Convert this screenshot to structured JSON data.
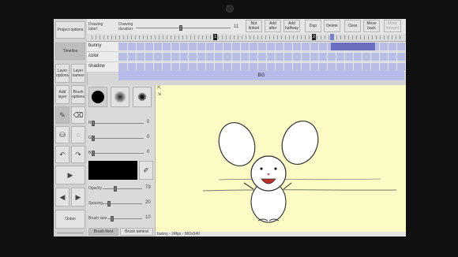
{
  "left_panel": {
    "project_options": "Project options",
    "timeline": "Timeline",
    "layer_options": "Layer options",
    "layer_names": "Layer names",
    "add_layer": "Add layer",
    "brush_options": "Brush options",
    "onion": "Onion"
  },
  "top_bar": {
    "drawing_label": "Drawing label:",
    "drawing_duration": "Drawing duration:",
    "duration_value": "11",
    "not_linked": "Not linked",
    "add_after": "Add after",
    "add_halfway": "Add halfway",
    "dup": "Dup",
    "delete": "Delete",
    "clear": "Clear",
    "move_back": "Move back",
    "move_forward": "Move forward"
  },
  "ruler": {
    "markers": [
      "1",
      "2"
    ]
  },
  "layers": [
    {
      "name": "bunny"
    },
    {
      "name": "color"
    },
    {
      "name": "shadow"
    }
  ],
  "bg_layer": "BG",
  "brush_panel": {
    "r_label": "R",
    "r_value": "0",
    "g_label": "G",
    "g_value": "0",
    "b_label": "B",
    "b_value": "0",
    "opacity_label": "Opacity",
    "opacity_value": "79",
    "spacing_label": "Spacing",
    "spacing_value": "20",
    "brush_size_label": "Brush size",
    "brush_size_value": "10",
    "brush_front": "Brush front",
    "brush_behind": "Brush behind"
  },
  "status_bar": "bunny - 24fps - 960x540",
  "colors": {
    "canvas": "#fdfbc5",
    "frames": "#b9bde6",
    "selected": "#6a6fbf"
  }
}
